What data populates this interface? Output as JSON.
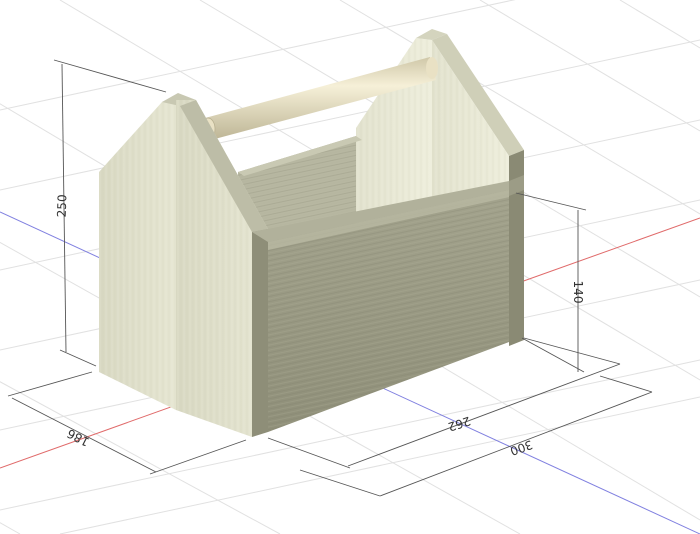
{
  "colors": {
    "background": "#ffffff",
    "grid": "#e1e1e1",
    "axis_x": "#e06a6a",
    "axis_y": "#8080e0",
    "wood_light": "#e8e8d4",
    "wood_mid": "#d9d9c2",
    "wood_dark": "#9a9a84",
    "dowel": "#ede5c8",
    "dimension_line": "#555555"
  },
  "model": {
    "name": "wooden-tool-caddy",
    "parts": [
      "left-end-panel",
      "right-end-panel",
      "front-side-board",
      "back-side-board",
      "handle-dowel"
    ]
  },
  "dimensions": {
    "height_total": "250",
    "height_side": "140",
    "depth": "186",
    "length_inner": "262",
    "length_total": "300"
  }
}
